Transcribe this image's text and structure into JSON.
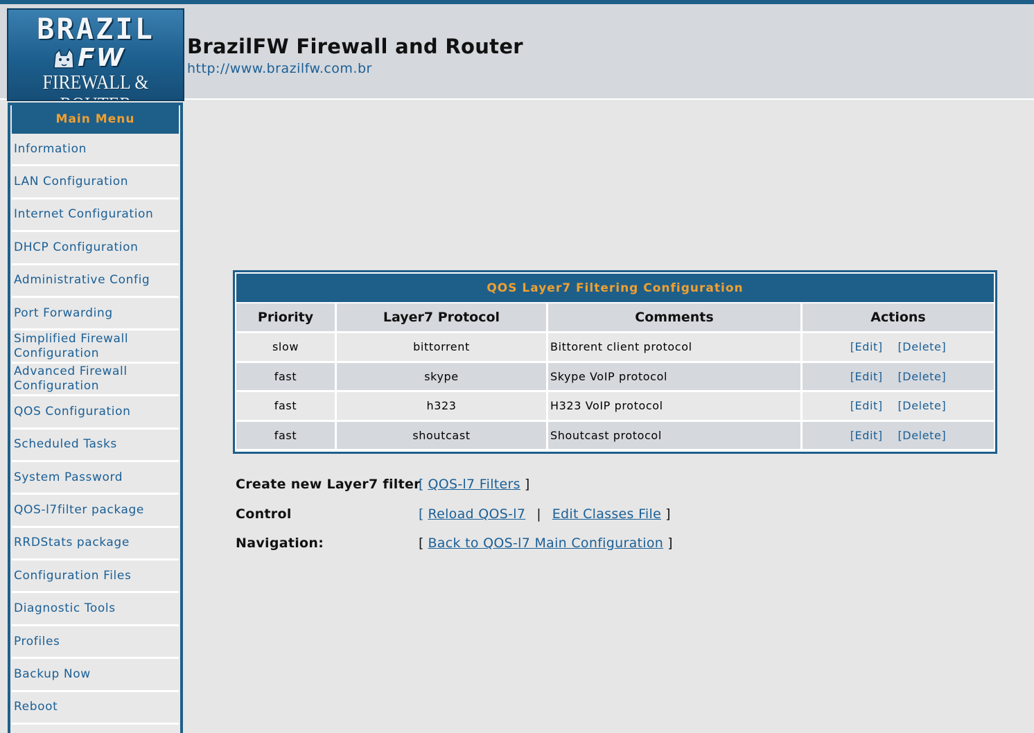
{
  "header": {
    "logo": {
      "line1": "BRAZIL",
      "line2": "FW",
      "line3": "FIREWALL & ROUTER"
    },
    "title": "BrazilFW Firewall and Router",
    "url": "http://www.brazilfw.com.br"
  },
  "sidebar": {
    "heading": "Main Menu",
    "items": [
      {
        "label": "Information"
      },
      {
        "label": "LAN Configuration"
      },
      {
        "label": "Internet Configuration"
      },
      {
        "label": "DHCP Configuration"
      },
      {
        "label": "Administrative Config"
      },
      {
        "label": "Port Forwarding"
      },
      {
        "label": "Simplified Firewall Configuration"
      },
      {
        "label": "Advanced Firewall Configuration"
      },
      {
        "label": "QOS Configuration"
      },
      {
        "label": "Scheduled Tasks"
      },
      {
        "label": "System Password"
      },
      {
        "label": "QOS-l7filter package"
      },
      {
        "label": "RRDStats package"
      },
      {
        "label": "Configuration Files"
      },
      {
        "label": "Diagnostic Tools"
      },
      {
        "label": "Profiles"
      },
      {
        "label": "Backup Now"
      },
      {
        "label": "Reboot"
      }
    ]
  },
  "qos_table": {
    "caption": "QOS Layer7 Filtering Configuration",
    "columns": [
      "Priority",
      "Layer7 Protocol",
      "Comments",
      "Actions"
    ],
    "rows": [
      {
        "priority": "slow",
        "protocol": "bittorrent",
        "comment": "Bittorent client protocol",
        "edit": "[Edit]",
        "delete": "[Delete]"
      },
      {
        "priority": "fast",
        "protocol": "skype",
        "comment": "Skype VoIP protocol",
        "edit": "[Edit]",
        "delete": "[Delete]"
      },
      {
        "priority": "fast",
        "protocol": "h323",
        "comment": "H323 VoIP protocol",
        "edit": "[Edit]",
        "delete": "[Delete]"
      },
      {
        "priority": "fast",
        "protocol": "shoutcast",
        "comment": "Shoutcast protocol",
        "edit": "[Edit]",
        "delete": "[Delete]"
      }
    ]
  },
  "controls": {
    "create": {
      "label": "Create new Layer7 filter",
      "link": "QOS-l7 Filters"
    },
    "control": {
      "label": "Control",
      "reload": "Reload QOS-l7",
      "edit_classes": "Edit Classes File"
    },
    "navigation": {
      "label": "Navigation:",
      "back": "Back to QOS-l7 Main Configuration"
    }
  },
  "colors": {
    "brand_blue": "#1e5f8a",
    "accent_orange": "#f0a030",
    "link_blue": "#1a5f96"
  }
}
